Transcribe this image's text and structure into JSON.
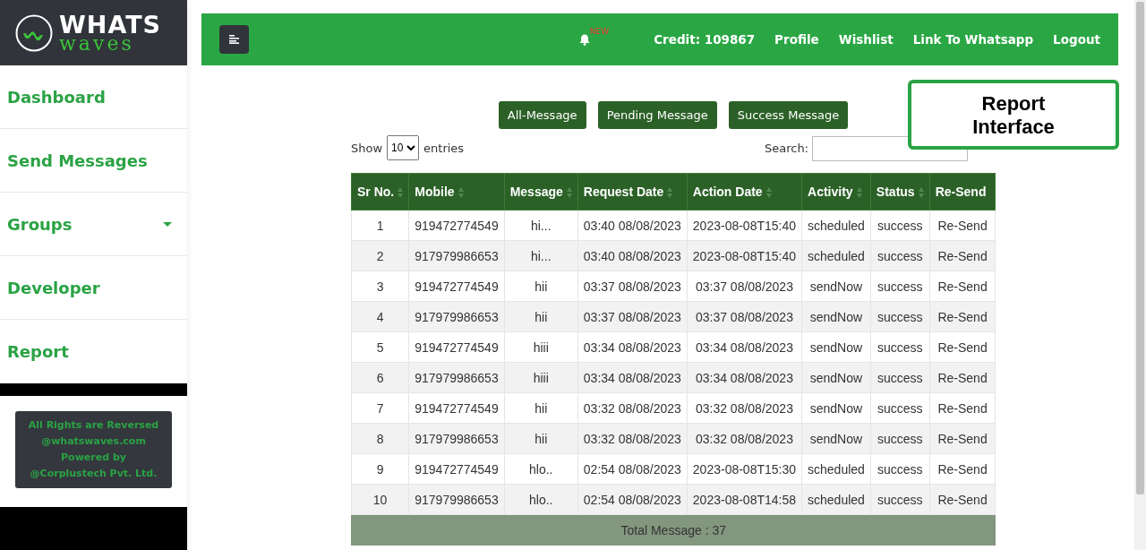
{
  "logo": {
    "word_1": "WHATS",
    "word_2": "waves"
  },
  "sidebar": {
    "items": [
      {
        "label": "Dashboard",
        "has_submenu": false
      },
      {
        "label": "Send Messages",
        "has_submenu": false
      },
      {
        "label": "Groups",
        "has_submenu": true
      },
      {
        "label": "Developer",
        "has_submenu": false
      },
      {
        "label": "Report",
        "has_submenu": false
      }
    ],
    "footer": [
      "All Rights are Reversed",
      "@whatswaves.com",
      "Powered by",
      "@Corplustech Pvt. Ltd."
    ]
  },
  "topbar": {
    "notification_badge": "NEW",
    "links": [
      "Credit: 109867",
      "Profile",
      "Wishlist",
      "Link To Whatsapp",
      "Logout"
    ]
  },
  "filters": [
    {
      "label": "All-Message"
    },
    {
      "label": "Pending Message"
    },
    {
      "label": "Success Message"
    }
  ],
  "entries": {
    "prefix": "Show",
    "value": "10",
    "suffix": "entries"
  },
  "search": {
    "label": "Search:"
  },
  "callout": "Report Interface",
  "table": {
    "columns": [
      {
        "label": "Sr No.",
        "sortable": true
      },
      {
        "label": "Mobile",
        "sortable": true
      },
      {
        "label": "Message",
        "sortable": true
      },
      {
        "label": "Request Date",
        "sortable": true
      },
      {
        "label": "Action Date",
        "sortable": true
      },
      {
        "label": "Activity",
        "sortable": true
      },
      {
        "label": "Status",
        "sortable": true
      },
      {
        "label": "Re-Send",
        "sortable": false
      }
    ],
    "rows": [
      [
        "1",
        "919472774549",
        "hi...",
        "03:40 08/08/2023",
        "2023-08-08T15:40",
        "scheduled",
        "success",
        "Re-Send"
      ],
      [
        "2",
        "917979986653",
        "hi...",
        "03:40 08/08/2023",
        "2023-08-08T15:40",
        "scheduled",
        "success",
        "Re-Send"
      ],
      [
        "3",
        "919472774549",
        "hii",
        "03:37 08/08/2023",
        "03:37 08/08/2023",
        "sendNow",
        "success",
        "Re-Send"
      ],
      [
        "4",
        "917979986653",
        "hii",
        "03:37 08/08/2023",
        "03:37 08/08/2023",
        "sendNow",
        "success",
        "Re-Send"
      ],
      [
        "5",
        "919472774549",
        "hiii",
        "03:34 08/08/2023",
        "03:34 08/08/2023",
        "sendNow",
        "success",
        "Re-Send"
      ],
      [
        "6",
        "917979986653",
        "hiii",
        "03:34 08/08/2023",
        "03:34 08/08/2023",
        "sendNow",
        "success",
        "Re-Send"
      ],
      [
        "7",
        "919472774549",
        "hii",
        "03:32 08/08/2023",
        "03:32 08/08/2023",
        "sendNow",
        "success",
        "Re-Send"
      ],
      [
        "8",
        "917979986653",
        "hii",
        "03:32 08/08/2023",
        "03:32 08/08/2023",
        "sendNow",
        "success",
        "Re-Send"
      ],
      [
        "9",
        "919472774549",
        "hlo..",
        "02:54 08/08/2023",
        "2023-08-08T15:30",
        "scheduled",
        "success",
        "Re-Send"
      ],
      [
        "10",
        "917979986653",
        "hlo..",
        "02:54 08/08/2023",
        "2023-08-08T14:58",
        "scheduled",
        "success",
        "Re-Send"
      ]
    ],
    "footer": "Total Message : 37"
  }
}
